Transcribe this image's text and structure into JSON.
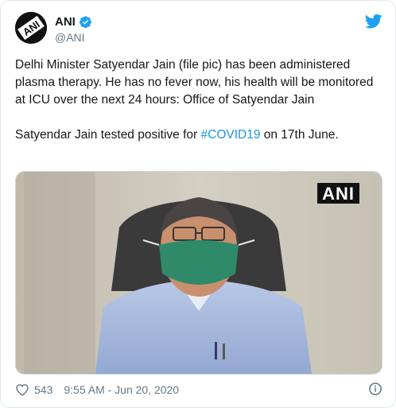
{
  "author": {
    "display_name": "ANI",
    "handle": "@ANI",
    "avatar_text": "ANI"
  },
  "tweet": {
    "paragraph1": "Delhi Minister Satyendar Jain (file pic) has been administered plasma therapy. He has no fever now, his health will be monitored at ICU over the next 24 hours: Office of Satyendar Jain",
    "paragraph2_before": "Satyendar Jain tested positive for ",
    "hashtag": "#COVID19",
    "paragraph2_after": " on 17th June."
  },
  "media": {
    "watermark": "ANI"
  },
  "footer": {
    "likes": "543",
    "timestamp": "9:55 AM - Jun 20, 2020"
  },
  "colors": {
    "accent": "#1da1f2",
    "hashtag": "#1b95e0",
    "muted": "#657786",
    "heart": "#657786"
  },
  "icons": [
    "verified-icon",
    "twitter-bird-icon",
    "heart-icon",
    "info-icon"
  ]
}
